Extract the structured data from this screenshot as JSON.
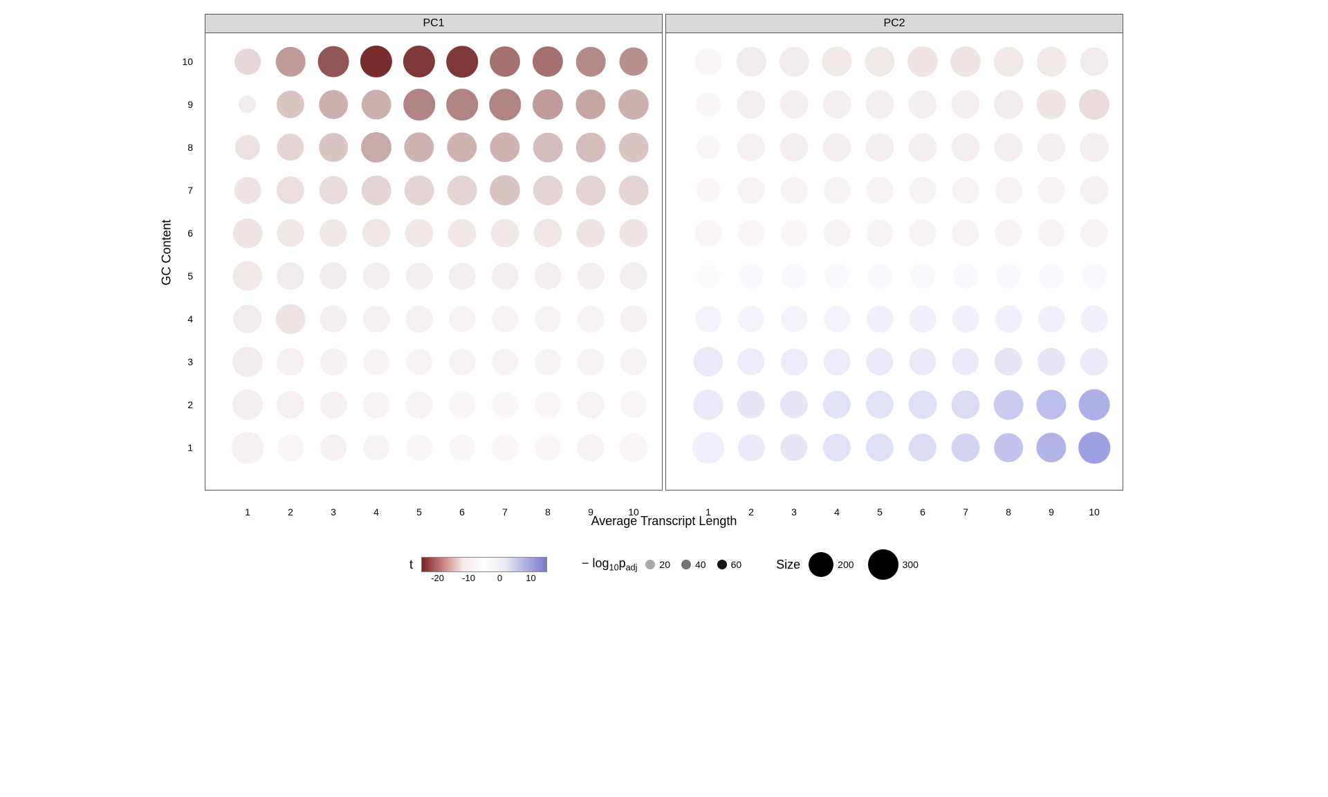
{
  "chart_data": {
    "type": "bubble-grid",
    "facets": [
      "PC1",
      "PC2"
    ],
    "xlabel": "Average Transcript Length",
    "ylabel": "GC Content",
    "x_categories": [
      1,
      2,
      3,
      4,
      5,
      6,
      7,
      8,
      9,
      10
    ],
    "y_categories": [
      1,
      2,
      3,
      4,
      5,
      6,
      7,
      8,
      9,
      10
    ],
    "color_variable": "t",
    "color_range": [
      -25,
      15
    ],
    "color_ticks": [
      -20,
      -10,
      0,
      10
    ],
    "alpha_variable": "-log10 p_adj",
    "alpha_ticks": [
      20,
      40,
      60
    ],
    "size_variable": "Size",
    "size_ticks": [
      200,
      300
    ],
    "panels": {
      "PC1": {
        "t": [
          [
            -4,
            -2,
            -4,
            -3,
            -2,
            -2,
            -2,
            -2,
            -3,
            -2
          ],
          [
            -5,
            -4,
            -4,
            -3,
            -3,
            -2,
            -2,
            -2,
            -3,
            -2
          ],
          [
            -6,
            -4,
            -4,
            -3,
            -3,
            -3,
            -3,
            -3,
            -3,
            -3
          ],
          [
            -6,
            -8,
            -5,
            -4,
            -4,
            -3,
            -3,
            -3,
            -3,
            -4
          ],
          [
            -7,
            -6,
            -6,
            -5,
            -5,
            -5,
            -5,
            -5,
            -5,
            -5
          ],
          [
            -8,
            -7,
            -7,
            -7,
            -7,
            -7,
            -7,
            -7,
            -8,
            -8
          ],
          [
            -8,
            -9,
            -9,
            -10,
            -10,
            -10,
            -12,
            -10,
            -10,
            -10
          ],
          [
            -9,
            -10,
            -12,
            -15,
            -14,
            -14,
            -14,
            -13,
            -13,
            -12
          ],
          [
            -6,
            -12,
            -14,
            -14,
            -18,
            -18,
            -18,
            -16,
            -15,
            -14
          ],
          [
            -10,
            -16,
            -22,
            -25,
            -24,
            -24,
            -20,
            -20,
            -18,
            -18
          ]
        ],
        "size": [
          [
            320,
            230,
            220,
            220,
            220,
            220,
            220,
            220,
            230,
            260
          ],
          [
            300,
            250,
            230,
            230,
            230,
            230,
            220,
            220,
            230,
            240
          ],
          [
            300,
            250,
            230,
            220,
            220,
            220,
            220,
            220,
            230,
            240
          ],
          [
            260,
            280,
            240,
            230,
            230,
            220,
            220,
            220,
            230,
            240
          ],
          [
            290,
            250,
            240,
            230,
            230,
            230,
            230,
            230,
            230,
            250
          ],
          [
            280,
            250,
            250,
            260,
            260,
            260,
            260,
            260,
            260,
            260
          ],
          [
            230,
            250,
            260,
            280,
            280,
            280,
            300,
            280,
            280,
            280
          ],
          [
            200,
            240,
            270,
            300,
            290,
            290,
            290,
            280,
            280,
            280
          ],
          [
            100,
            250,
            270,
            280,
            320,
            320,
            320,
            300,
            290,
            300
          ],
          [
            220,
            280,
            310,
            330,
            330,
            320,
            300,
            300,
            280,
            260
          ]
        ],
        "alpha": [
          [
            18,
            19,
            20,
            20,
            20,
            20,
            20,
            20,
            20,
            20
          ],
          [
            20,
            22,
            22,
            22,
            22,
            22,
            22,
            22,
            22,
            22
          ],
          [
            22,
            24,
            24,
            24,
            24,
            24,
            24,
            24,
            24,
            24
          ],
          [
            24,
            28,
            26,
            24,
            24,
            24,
            24,
            24,
            24,
            24
          ],
          [
            26,
            28,
            28,
            26,
            26,
            26,
            26,
            26,
            26,
            26
          ],
          [
            28,
            30,
            30,
            30,
            30,
            30,
            30,
            30,
            30,
            30
          ],
          [
            28,
            32,
            34,
            36,
            36,
            36,
            40,
            36,
            36,
            36
          ],
          [
            28,
            36,
            40,
            46,
            44,
            44,
            44,
            42,
            42,
            40
          ],
          [
            20,
            40,
            46,
            46,
            54,
            54,
            54,
            50,
            48,
            46
          ],
          [
            34,
            50,
            60,
            66,
            64,
            64,
            56,
            56,
            52,
            50
          ]
        ]
      },
      "PC2": {
        "t": [
          [
            4,
            6,
            7,
            8,
            9,
            10,
            11,
            13,
            14,
            16
          ],
          [
            6,
            7,
            7,
            8,
            8,
            9,
            10,
            12,
            13,
            14
          ],
          [
            6,
            5,
            5,
            5,
            6,
            6,
            6,
            7,
            7,
            6
          ],
          [
            3,
            3,
            3,
            3,
            4,
            4,
            4,
            4,
            4,
            4
          ],
          [
            0,
            1,
            1,
            1,
            1,
            1,
            1,
            1,
            1,
            1
          ],
          [
            -2,
            -2,
            -2,
            -3,
            -3,
            -3,
            -3,
            -3,
            -3,
            -3
          ],
          [
            -2,
            -3,
            -3,
            -3,
            -3,
            -3,
            -3,
            -3,
            -3,
            -4
          ],
          [
            -2,
            -4,
            -5,
            -5,
            -5,
            -5,
            -5,
            -5,
            -5,
            -5
          ],
          [
            -2,
            -5,
            -5,
            -5,
            -5,
            -5,
            -5,
            -6,
            -8,
            -10
          ],
          [
            -2,
            -6,
            -6,
            -7,
            -7,
            -8,
            -8,
            -7,
            -7,
            -6
          ]
        ],
        "size": [
          [
            320,
            230,
            240,
            250,
            250,
            250,
            260,
            270,
            290,
            320
          ],
          [
            300,
            250,
            250,
            250,
            250,
            260,
            260,
            280,
            290,
            310
          ],
          [
            290,
            240,
            230,
            230,
            240,
            240,
            240,
            250,
            250,
            250
          ],
          [
            220,
            220,
            220,
            220,
            230,
            230,
            230,
            230,
            230,
            230
          ],
          [
            180,
            200,
            200,
            200,
            200,
            200,
            200,
            200,
            200,
            200
          ],
          [
            240,
            230,
            230,
            240,
            240,
            240,
            240,
            240,
            240,
            250
          ],
          [
            190,
            230,
            230,
            230,
            230,
            230,
            230,
            230,
            230,
            260
          ],
          [
            180,
            250,
            260,
            260,
            260,
            260,
            260,
            260,
            260,
            270
          ],
          [
            200,
            260,
            260,
            260,
            260,
            260,
            260,
            270,
            290,
            300
          ],
          [
            230,
            280,
            280,
            290,
            290,
            300,
            300,
            280,
            280,
            260
          ]
        ],
        "alpha": [
          [
            18,
            22,
            24,
            26,
            28,
            30,
            32,
            36,
            40,
            46
          ],
          [
            20,
            24,
            24,
            26,
            26,
            28,
            30,
            34,
            38,
            42
          ],
          [
            22,
            22,
            22,
            22,
            24,
            24,
            24,
            26,
            26,
            24
          ],
          [
            19,
            20,
            20,
            20,
            21,
            21,
            21,
            21,
            21,
            21
          ],
          [
            17,
            18,
            18,
            18,
            18,
            18,
            18,
            18,
            18,
            18
          ],
          [
            20,
            20,
            20,
            21,
            21,
            21,
            21,
            21,
            21,
            21
          ],
          [
            19,
            21,
            21,
            21,
            21,
            21,
            21,
            21,
            21,
            23
          ],
          [
            18,
            23,
            24,
            24,
            24,
            24,
            24,
            24,
            24,
            25
          ],
          [
            19,
            24,
            24,
            24,
            24,
            24,
            24,
            25,
            28,
            32
          ],
          [
            21,
            26,
            26,
            27,
            27,
            28,
            28,
            26,
            26,
            24
          ]
        ]
      }
    }
  },
  "legend": {
    "color_title": "t",
    "alpha_title_html": "− log<sub>10</sub>p<sub>adj</sub>",
    "size_title": "Size"
  }
}
